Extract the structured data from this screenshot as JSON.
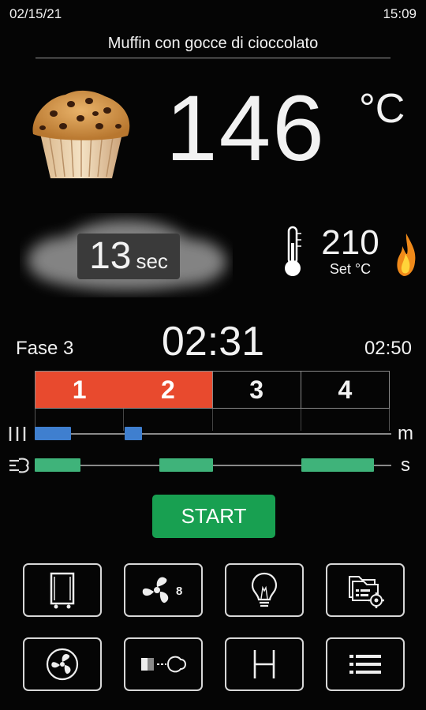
{
  "status_bar": {
    "date": "02/15/21",
    "time": "15:09"
  },
  "recipe": {
    "name": "Muffin con gocce di cioccolato",
    "image_icon": "muffin-icon"
  },
  "temperature": {
    "current": "146",
    "unit": "°C"
  },
  "humidity": {
    "value": "13",
    "unit": "sec",
    "icon": "steam-cloud-icon"
  },
  "setpoint": {
    "value": "210",
    "label": "Set °C",
    "icon": "thermometer-icon",
    "heat_icon": "flame-icon"
  },
  "cycle": {
    "phase_label": "Fase 3",
    "elapsed": "02:31",
    "total": "02:50",
    "phases": [
      {
        "label": "1",
        "active": true
      },
      {
        "label": "2",
        "active": true
      },
      {
        "label": "3",
        "active": false
      },
      {
        "label": "4",
        "active": false
      }
    ]
  },
  "tracks": {
    "damper": {
      "unit_label": "m",
      "icon": "damper-icon",
      "color": "#3f7fcf"
    },
    "steam": {
      "unit_label": "s",
      "icon": "steam-injection-icon",
      "color": "#3fb37a"
    }
  },
  "start_button": {
    "label": "START",
    "color": "#18a051"
  },
  "toolbar": [
    {
      "name": "door-icon"
    },
    {
      "name": "fan-speed-icon",
      "badge": "8"
    },
    {
      "name": "light-bulb-icon"
    },
    {
      "name": "recipe-folder-settings-icon"
    },
    {
      "name": "fan-reverse-icon"
    },
    {
      "name": "steam-valve-icon"
    },
    {
      "name": "hold-icon"
    },
    {
      "name": "menu-list-icon"
    }
  ],
  "colors": {
    "active_phase": "#e84a2e",
    "background": "#050505"
  }
}
